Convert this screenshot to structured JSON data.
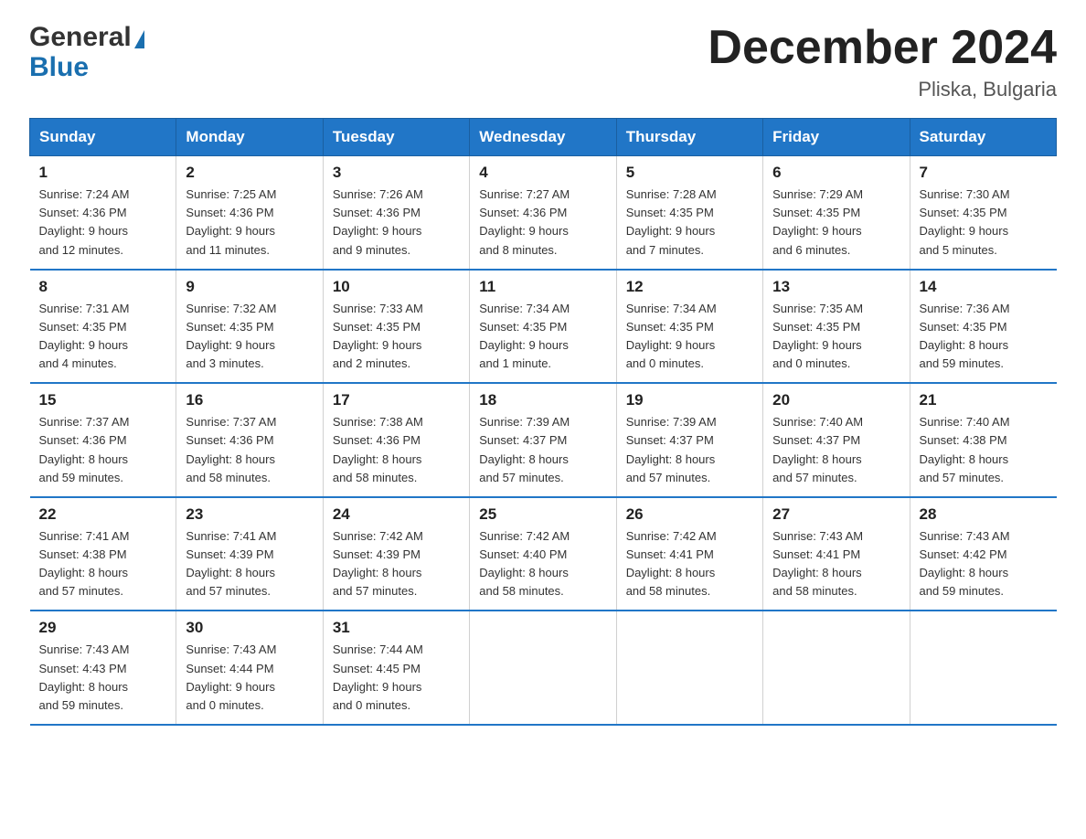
{
  "header": {
    "logo_general": "General",
    "logo_blue": "Blue",
    "title": "December 2024",
    "location": "Pliska, Bulgaria"
  },
  "weekdays": [
    "Sunday",
    "Monday",
    "Tuesday",
    "Wednesday",
    "Thursday",
    "Friday",
    "Saturday"
  ],
  "weeks": [
    [
      {
        "day": "1",
        "info": "Sunrise: 7:24 AM\nSunset: 4:36 PM\nDaylight: 9 hours\nand 12 minutes."
      },
      {
        "day": "2",
        "info": "Sunrise: 7:25 AM\nSunset: 4:36 PM\nDaylight: 9 hours\nand 11 minutes."
      },
      {
        "day": "3",
        "info": "Sunrise: 7:26 AM\nSunset: 4:36 PM\nDaylight: 9 hours\nand 9 minutes."
      },
      {
        "day": "4",
        "info": "Sunrise: 7:27 AM\nSunset: 4:36 PM\nDaylight: 9 hours\nand 8 minutes."
      },
      {
        "day": "5",
        "info": "Sunrise: 7:28 AM\nSunset: 4:35 PM\nDaylight: 9 hours\nand 7 minutes."
      },
      {
        "day": "6",
        "info": "Sunrise: 7:29 AM\nSunset: 4:35 PM\nDaylight: 9 hours\nand 6 minutes."
      },
      {
        "day": "7",
        "info": "Sunrise: 7:30 AM\nSunset: 4:35 PM\nDaylight: 9 hours\nand 5 minutes."
      }
    ],
    [
      {
        "day": "8",
        "info": "Sunrise: 7:31 AM\nSunset: 4:35 PM\nDaylight: 9 hours\nand 4 minutes."
      },
      {
        "day": "9",
        "info": "Sunrise: 7:32 AM\nSunset: 4:35 PM\nDaylight: 9 hours\nand 3 minutes."
      },
      {
        "day": "10",
        "info": "Sunrise: 7:33 AM\nSunset: 4:35 PM\nDaylight: 9 hours\nand 2 minutes."
      },
      {
        "day": "11",
        "info": "Sunrise: 7:34 AM\nSunset: 4:35 PM\nDaylight: 9 hours\nand 1 minute."
      },
      {
        "day": "12",
        "info": "Sunrise: 7:34 AM\nSunset: 4:35 PM\nDaylight: 9 hours\nand 0 minutes."
      },
      {
        "day": "13",
        "info": "Sunrise: 7:35 AM\nSunset: 4:35 PM\nDaylight: 9 hours\nand 0 minutes."
      },
      {
        "day": "14",
        "info": "Sunrise: 7:36 AM\nSunset: 4:35 PM\nDaylight: 8 hours\nand 59 minutes."
      }
    ],
    [
      {
        "day": "15",
        "info": "Sunrise: 7:37 AM\nSunset: 4:36 PM\nDaylight: 8 hours\nand 59 minutes."
      },
      {
        "day": "16",
        "info": "Sunrise: 7:37 AM\nSunset: 4:36 PM\nDaylight: 8 hours\nand 58 minutes."
      },
      {
        "day": "17",
        "info": "Sunrise: 7:38 AM\nSunset: 4:36 PM\nDaylight: 8 hours\nand 58 minutes."
      },
      {
        "day": "18",
        "info": "Sunrise: 7:39 AM\nSunset: 4:37 PM\nDaylight: 8 hours\nand 57 minutes."
      },
      {
        "day": "19",
        "info": "Sunrise: 7:39 AM\nSunset: 4:37 PM\nDaylight: 8 hours\nand 57 minutes."
      },
      {
        "day": "20",
        "info": "Sunrise: 7:40 AM\nSunset: 4:37 PM\nDaylight: 8 hours\nand 57 minutes."
      },
      {
        "day": "21",
        "info": "Sunrise: 7:40 AM\nSunset: 4:38 PM\nDaylight: 8 hours\nand 57 minutes."
      }
    ],
    [
      {
        "day": "22",
        "info": "Sunrise: 7:41 AM\nSunset: 4:38 PM\nDaylight: 8 hours\nand 57 minutes."
      },
      {
        "day": "23",
        "info": "Sunrise: 7:41 AM\nSunset: 4:39 PM\nDaylight: 8 hours\nand 57 minutes."
      },
      {
        "day": "24",
        "info": "Sunrise: 7:42 AM\nSunset: 4:39 PM\nDaylight: 8 hours\nand 57 minutes."
      },
      {
        "day": "25",
        "info": "Sunrise: 7:42 AM\nSunset: 4:40 PM\nDaylight: 8 hours\nand 58 minutes."
      },
      {
        "day": "26",
        "info": "Sunrise: 7:42 AM\nSunset: 4:41 PM\nDaylight: 8 hours\nand 58 minutes."
      },
      {
        "day": "27",
        "info": "Sunrise: 7:43 AM\nSunset: 4:41 PM\nDaylight: 8 hours\nand 58 minutes."
      },
      {
        "day": "28",
        "info": "Sunrise: 7:43 AM\nSunset: 4:42 PM\nDaylight: 8 hours\nand 59 minutes."
      }
    ],
    [
      {
        "day": "29",
        "info": "Sunrise: 7:43 AM\nSunset: 4:43 PM\nDaylight: 8 hours\nand 59 minutes."
      },
      {
        "day": "30",
        "info": "Sunrise: 7:43 AM\nSunset: 4:44 PM\nDaylight: 9 hours\nand 0 minutes."
      },
      {
        "day": "31",
        "info": "Sunrise: 7:44 AM\nSunset: 4:45 PM\nDaylight: 9 hours\nand 0 minutes."
      },
      {
        "day": "",
        "info": ""
      },
      {
        "day": "",
        "info": ""
      },
      {
        "day": "",
        "info": ""
      },
      {
        "day": "",
        "info": ""
      }
    ]
  ]
}
